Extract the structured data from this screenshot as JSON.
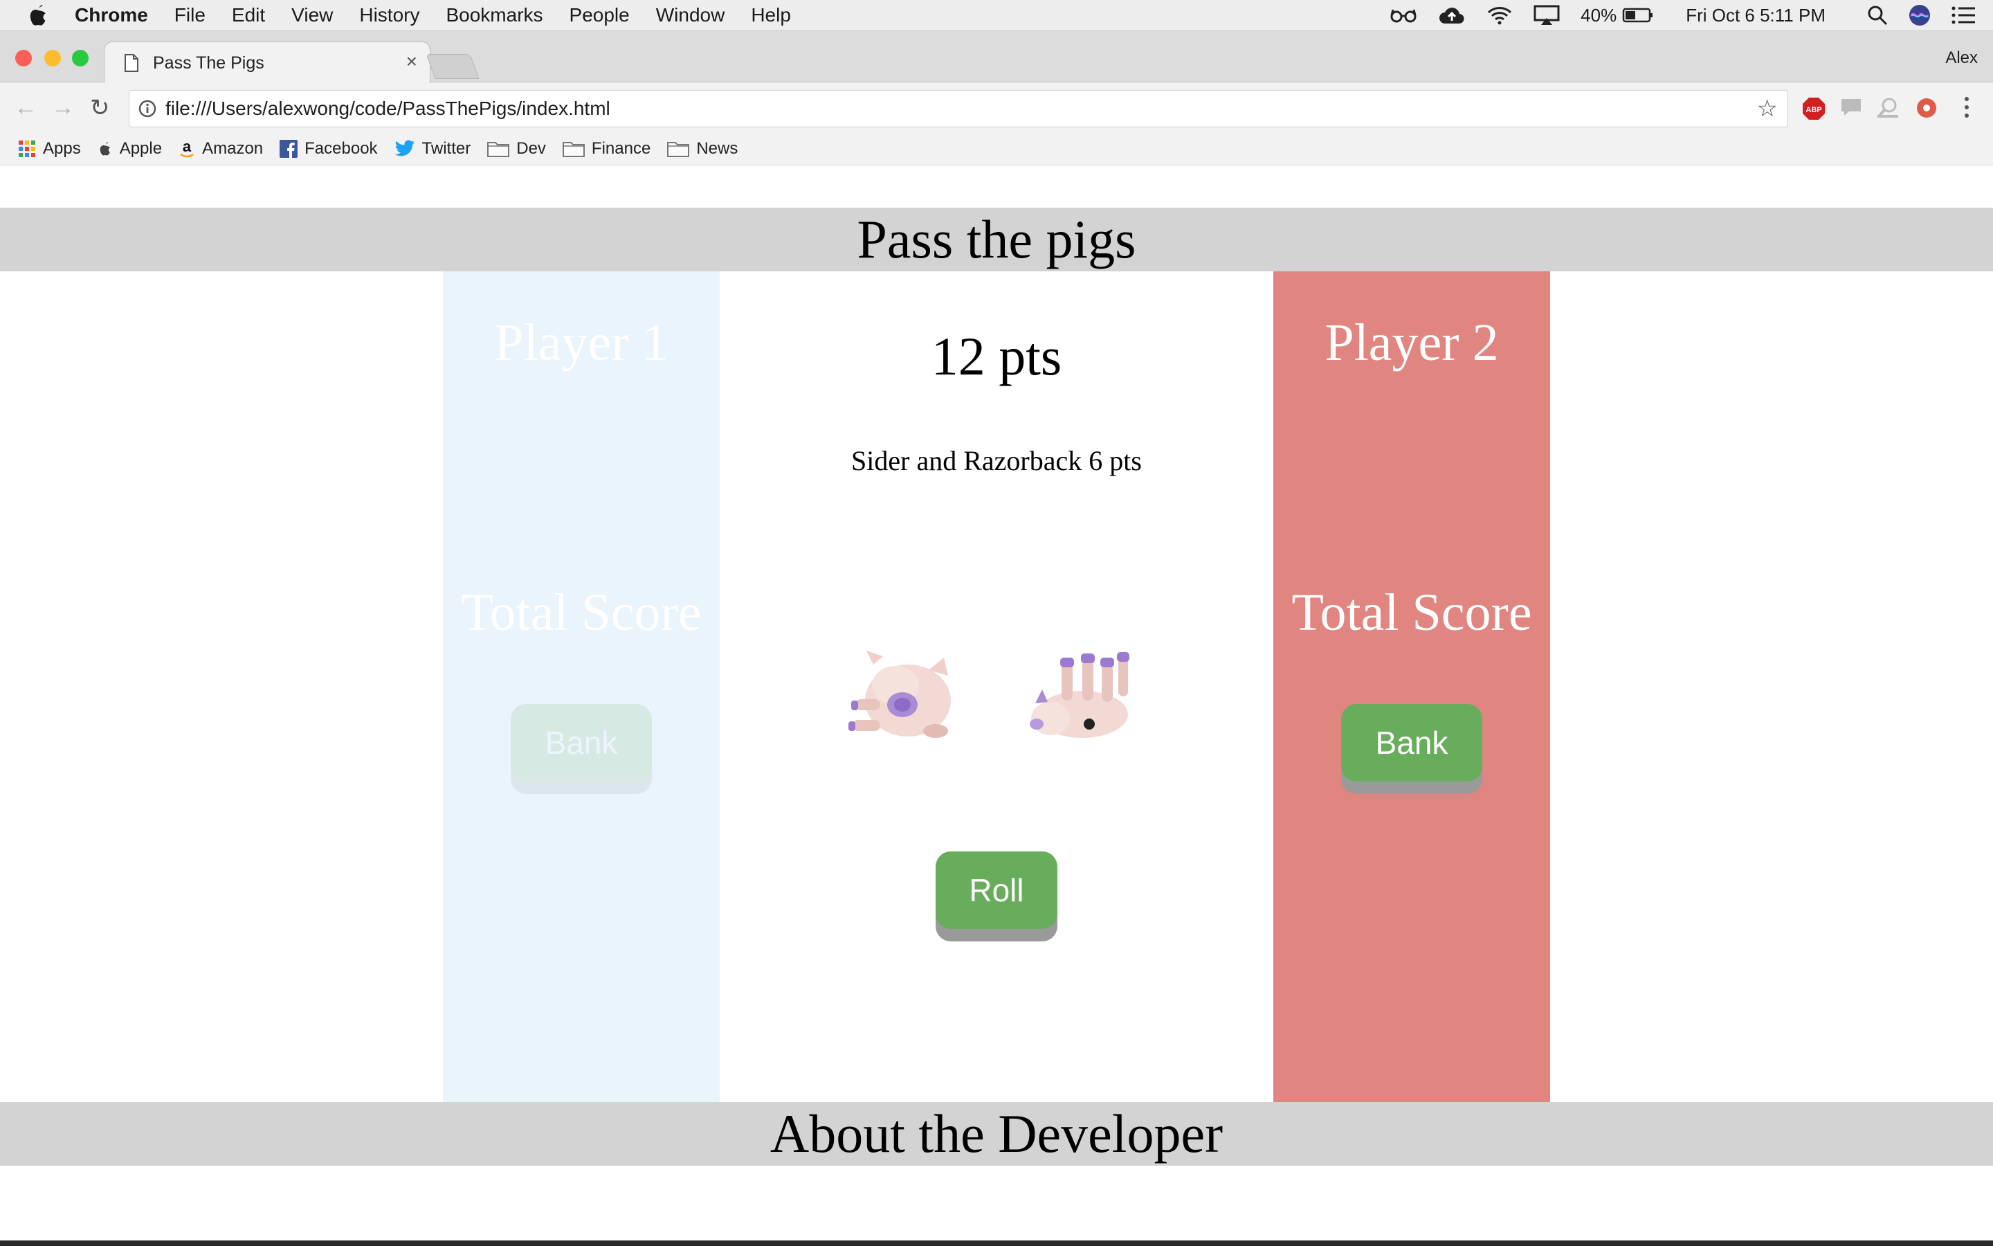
{
  "menubar": {
    "app_name": "Chrome",
    "items": [
      "File",
      "Edit",
      "View",
      "History",
      "Bookmarks",
      "People",
      "Window",
      "Help"
    ],
    "battery": "40%",
    "datetime": "Fri Oct 6  5:11 PM"
  },
  "browser": {
    "tab_title": "Pass The Pigs",
    "profile_name": "Alex",
    "url": "file:///Users/alexwong/code/PassThePigs/index.html",
    "bookmarks": [
      "Apps",
      "Apple",
      "Amazon",
      "Facebook",
      "Twitter",
      "Dev",
      "Finance",
      "News"
    ]
  },
  "page": {
    "header_title": "Pass the pigs",
    "player1": {
      "name": "Player 1",
      "total_label": "Total Score",
      "bank_label": "Bank",
      "color": "#eaf4fc"
    },
    "player2": {
      "name": "Player 2",
      "total_label": "Total Score",
      "bank_label": "Bank",
      "color": "#e08580"
    },
    "turn_points": "12 pts",
    "last_roll": "Sider and Razorback 6 pts",
    "roll_label": "Roll",
    "footer_title": "About the Developer",
    "button_color": "#67ad5b"
  }
}
